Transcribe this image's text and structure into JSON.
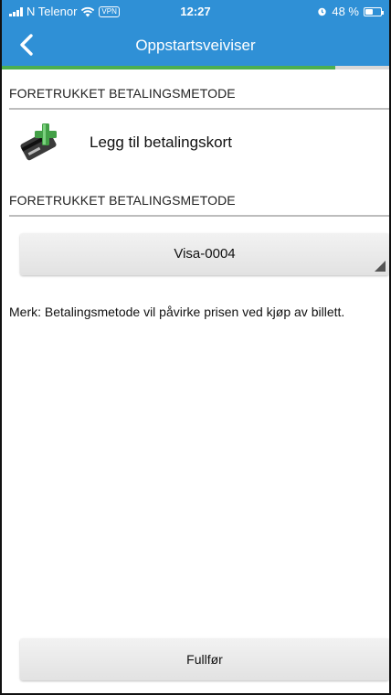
{
  "status_bar": {
    "carrier": "N Telenor",
    "vpn_label": "VPN",
    "time": "12:27",
    "battery": "48 %"
  },
  "nav": {
    "title": "Oppstartsveiviser"
  },
  "progress": {
    "fraction": 0.86,
    "fill_color": "#4caf50"
  },
  "section1": {
    "label": "FORETRUKKET BETALINGSMETODE",
    "add_card_label": "Legg til betalingskort",
    "add_card_icon": "add-card-icon"
  },
  "section2": {
    "label": "FORETRUKKET BETALINGSMETODE",
    "selected_method": "Visa-0004"
  },
  "note": "Merk: Betalingsmetode vil påvirke prisen ved kjøp av billett.",
  "finish_button": "Fullfør",
  "colors": {
    "header": "#2f90d6",
    "progress": "#4caf50"
  }
}
